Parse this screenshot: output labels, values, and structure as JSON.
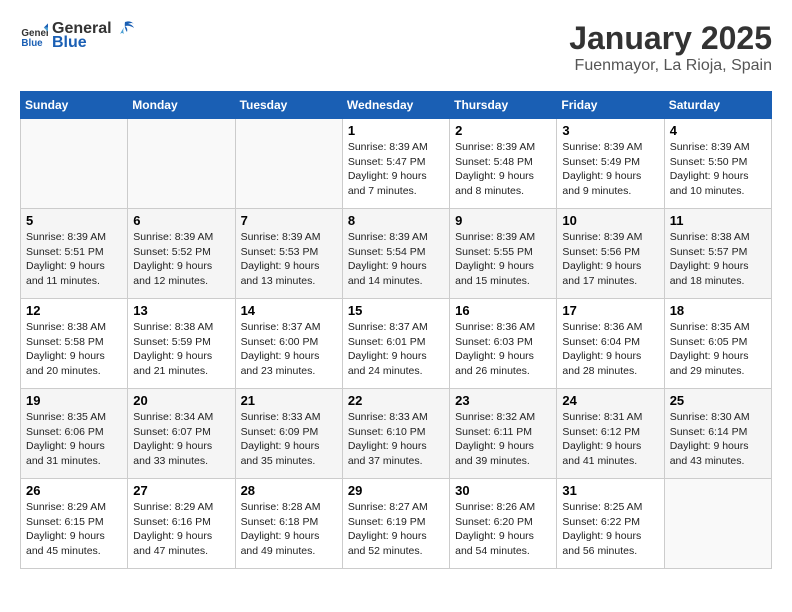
{
  "logo": {
    "text_general": "General",
    "text_blue": "Blue"
  },
  "title": "January 2025",
  "subtitle": "Fuenmayor, La Rioja, Spain",
  "weekdays": [
    "Sunday",
    "Monday",
    "Tuesday",
    "Wednesday",
    "Thursday",
    "Friday",
    "Saturday"
  ],
  "weeks": [
    [
      {
        "day": "",
        "info": ""
      },
      {
        "day": "",
        "info": ""
      },
      {
        "day": "",
        "info": ""
      },
      {
        "day": "1",
        "info": "Sunrise: 8:39 AM\nSunset: 5:47 PM\nDaylight: 9 hours\nand 7 minutes."
      },
      {
        "day": "2",
        "info": "Sunrise: 8:39 AM\nSunset: 5:48 PM\nDaylight: 9 hours\nand 8 minutes."
      },
      {
        "day": "3",
        "info": "Sunrise: 8:39 AM\nSunset: 5:49 PM\nDaylight: 9 hours\nand 9 minutes."
      },
      {
        "day": "4",
        "info": "Sunrise: 8:39 AM\nSunset: 5:50 PM\nDaylight: 9 hours\nand 10 minutes."
      }
    ],
    [
      {
        "day": "5",
        "info": "Sunrise: 8:39 AM\nSunset: 5:51 PM\nDaylight: 9 hours\nand 11 minutes."
      },
      {
        "day": "6",
        "info": "Sunrise: 8:39 AM\nSunset: 5:52 PM\nDaylight: 9 hours\nand 12 minutes."
      },
      {
        "day": "7",
        "info": "Sunrise: 8:39 AM\nSunset: 5:53 PM\nDaylight: 9 hours\nand 13 minutes."
      },
      {
        "day": "8",
        "info": "Sunrise: 8:39 AM\nSunset: 5:54 PM\nDaylight: 9 hours\nand 14 minutes."
      },
      {
        "day": "9",
        "info": "Sunrise: 8:39 AM\nSunset: 5:55 PM\nDaylight: 9 hours\nand 15 minutes."
      },
      {
        "day": "10",
        "info": "Sunrise: 8:39 AM\nSunset: 5:56 PM\nDaylight: 9 hours\nand 17 minutes."
      },
      {
        "day": "11",
        "info": "Sunrise: 8:38 AM\nSunset: 5:57 PM\nDaylight: 9 hours\nand 18 minutes."
      }
    ],
    [
      {
        "day": "12",
        "info": "Sunrise: 8:38 AM\nSunset: 5:58 PM\nDaylight: 9 hours\nand 20 minutes."
      },
      {
        "day": "13",
        "info": "Sunrise: 8:38 AM\nSunset: 5:59 PM\nDaylight: 9 hours\nand 21 minutes."
      },
      {
        "day": "14",
        "info": "Sunrise: 8:37 AM\nSunset: 6:00 PM\nDaylight: 9 hours\nand 23 minutes."
      },
      {
        "day": "15",
        "info": "Sunrise: 8:37 AM\nSunset: 6:01 PM\nDaylight: 9 hours\nand 24 minutes."
      },
      {
        "day": "16",
        "info": "Sunrise: 8:36 AM\nSunset: 6:03 PM\nDaylight: 9 hours\nand 26 minutes."
      },
      {
        "day": "17",
        "info": "Sunrise: 8:36 AM\nSunset: 6:04 PM\nDaylight: 9 hours\nand 28 minutes."
      },
      {
        "day": "18",
        "info": "Sunrise: 8:35 AM\nSunset: 6:05 PM\nDaylight: 9 hours\nand 29 minutes."
      }
    ],
    [
      {
        "day": "19",
        "info": "Sunrise: 8:35 AM\nSunset: 6:06 PM\nDaylight: 9 hours\nand 31 minutes."
      },
      {
        "day": "20",
        "info": "Sunrise: 8:34 AM\nSunset: 6:07 PM\nDaylight: 9 hours\nand 33 minutes."
      },
      {
        "day": "21",
        "info": "Sunrise: 8:33 AM\nSunset: 6:09 PM\nDaylight: 9 hours\nand 35 minutes."
      },
      {
        "day": "22",
        "info": "Sunrise: 8:33 AM\nSunset: 6:10 PM\nDaylight: 9 hours\nand 37 minutes."
      },
      {
        "day": "23",
        "info": "Sunrise: 8:32 AM\nSunset: 6:11 PM\nDaylight: 9 hours\nand 39 minutes."
      },
      {
        "day": "24",
        "info": "Sunrise: 8:31 AM\nSunset: 6:12 PM\nDaylight: 9 hours\nand 41 minutes."
      },
      {
        "day": "25",
        "info": "Sunrise: 8:30 AM\nSunset: 6:14 PM\nDaylight: 9 hours\nand 43 minutes."
      }
    ],
    [
      {
        "day": "26",
        "info": "Sunrise: 8:29 AM\nSunset: 6:15 PM\nDaylight: 9 hours\nand 45 minutes."
      },
      {
        "day": "27",
        "info": "Sunrise: 8:29 AM\nSunset: 6:16 PM\nDaylight: 9 hours\nand 47 minutes."
      },
      {
        "day": "28",
        "info": "Sunrise: 8:28 AM\nSunset: 6:18 PM\nDaylight: 9 hours\nand 49 minutes."
      },
      {
        "day": "29",
        "info": "Sunrise: 8:27 AM\nSunset: 6:19 PM\nDaylight: 9 hours\nand 52 minutes."
      },
      {
        "day": "30",
        "info": "Sunrise: 8:26 AM\nSunset: 6:20 PM\nDaylight: 9 hours\nand 54 minutes."
      },
      {
        "day": "31",
        "info": "Sunrise: 8:25 AM\nSunset: 6:22 PM\nDaylight: 9 hours\nand 56 minutes."
      },
      {
        "day": "",
        "info": ""
      }
    ]
  ]
}
